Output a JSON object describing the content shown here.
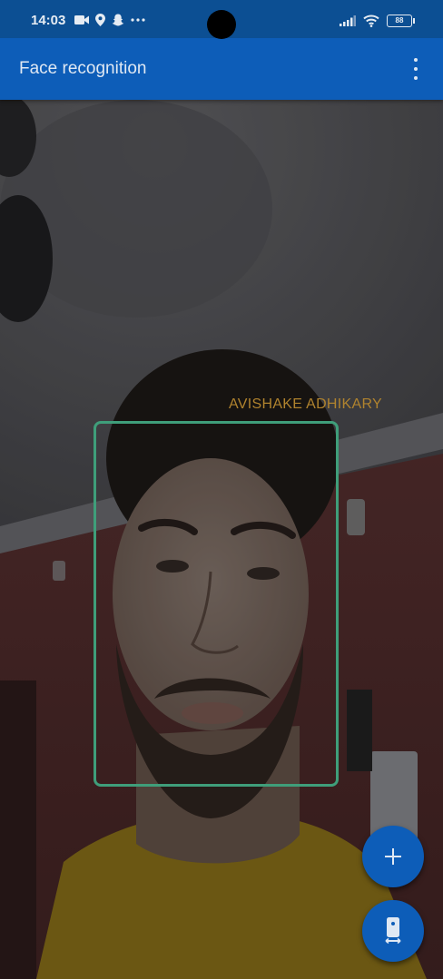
{
  "status_bar": {
    "time": "14:03",
    "battery": "88"
  },
  "app_bar": {
    "title": "Face recognition"
  },
  "recognition": {
    "name": "AVISHAKE ADHIKARY"
  },
  "colors": {
    "app_bar": "#0d5db8",
    "status_bar": "#0c4f93",
    "face_box": "#3f9e7a",
    "name_label": "#b0832e"
  },
  "icons": {
    "status": [
      "video-icon",
      "location-icon",
      "snapchat-icon",
      "more-dots-icon",
      "signal-icon",
      "wifi-icon",
      "battery-icon"
    ],
    "app_bar": [
      "overflow-menu-icon"
    ],
    "fabs": [
      "add-icon",
      "switch-camera-icon"
    ]
  }
}
